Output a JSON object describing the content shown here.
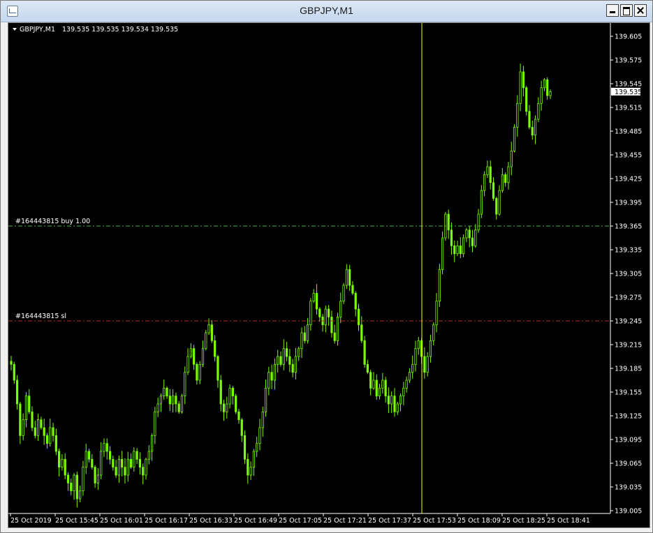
{
  "window": {
    "title": "GBPJPY,M1",
    "minimize_icon": "minimize-icon",
    "maximize_icon": "maximize-icon",
    "close_icon": "close-icon"
  },
  "chart_header": {
    "symbol_label": "GBPJPY,M1",
    "ohlc": "139.535 139.535 139.534 139.535"
  },
  "colors": {
    "background": "#000000",
    "candle": "#7CFC00",
    "buy_line": "#4caf50",
    "sl_line": "#b03020",
    "vline": "#ffff00",
    "axis": "#ffffff"
  },
  "lines": {
    "buy_label": "#164443815 buy 1.00",
    "buy_price": 139.365,
    "sl_label": "#164443815 sl",
    "sl_price": 139.245
  },
  "price_tag": "139.535",
  "chart_data": {
    "type": "candlestick",
    "symbol": "GBPJPY",
    "timeframe": "M1",
    "y_ticks": [
      "139.605",
      "139.575",
      "139.545",
      "139.515",
      "139.485",
      "139.455",
      "139.425",
      "139.395",
      "139.365",
      "139.335",
      "139.305",
      "139.275",
      "139.245",
      "139.215",
      "139.185",
      "139.155",
      "139.125",
      "139.095",
      "139.065",
      "139.035",
      "139.005"
    ],
    "ylim": [
      139.005,
      139.605
    ],
    "x_ticks": [
      "25 Oct 2019",
      "25 Oct 15:45",
      "25 Oct 16:01",
      "25 Oct 16:17",
      "25 Oct 16:33",
      "25 Oct 16:49",
      "25 Oct 17:05",
      "25 Oct 17:21",
      "25 Oct 17:37",
      "25 Oct 17:53",
      "25 Oct 18:09",
      "25 Oct 18:25",
      "25 Oct 18:41"
    ],
    "close_series": [
      139.19,
      139.17,
      139.14,
      139.1,
      139.12,
      139.15,
      139.13,
      139.11,
      139.1,
      139.12,
      139.11,
      139.1,
      139.09,
      139.11,
      139.1,
      139.08,
      139.06,
      139.07,
      139.05,
      139.04,
      139.03,
      139.05,
      139.02,
      139.03,
      139.06,
      139.08,
      139.07,
      139.06,
      139.04,
      139.05,
      139.08,
      139.09,
      139.08,
      139.07,
      139.06,
      139.05,
      139.07,
      139.06,
      139.05,
      139.07,
      139.06,
      139.08,
      139.07,
      139.06,
      139.05,
      139.07,
      139.08,
      139.1,
      139.13,
      139.14,
      139.15,
      139.16,
      139.15,
      139.14,
      139.15,
      139.14,
      139.13,
      139.15,
      139.18,
      139.2,
      139.21,
      139.19,
      139.17,
      139.19,
      139.21,
      139.23,
      139.24,
      139.22,
      139.2,
      139.17,
      139.14,
      139.13,
      139.14,
      139.16,
      139.15,
      139.13,
      139.12,
      139.1,
      139.07,
      139.05,
      139.06,
      139.08,
      139.09,
      139.11,
      139.13,
      139.16,
      139.18,
      139.17,
      139.19,
      139.2,
      139.19,
      139.21,
      139.2,
      139.19,
      139.18,
      139.2,
      139.21,
      139.23,
      139.22,
      139.24,
      139.27,
      139.28,
      139.26,
      139.25,
      139.24,
      139.26,
      139.25,
      139.23,
      139.22,
      139.25,
      139.27,
      139.29,
      139.31,
      139.29,
      139.28,
      139.26,
      139.24,
      139.22,
      139.19,
      139.18,
      139.16,
      139.17,
      139.15,
      139.16,
      139.17,
      139.15,
      139.14,
      139.15,
      139.13,
      139.14,
      139.15,
      139.16,
      139.17,
      139.18,
      139.19,
      139.21,
      139.22,
      139.2,
      139.18,
      139.2,
      139.22,
      139.24,
      139.27,
      139.31,
      139.35,
      139.38,
      139.36,
      139.34,
      139.33,
      139.34,
      139.33,
      139.35,
      139.36,
      139.35,
      139.34,
      139.36,
      139.38,
      139.41,
      139.43,
      139.44,
      139.42,
      139.4,
      139.38,
      139.41,
      139.43,
      139.42,
      139.44,
      139.46,
      139.49,
      139.52,
      139.56,
      139.54,
      139.51,
      139.49,
      139.48,
      139.5,
      139.52,
      139.54,
      139.55,
      139.53,
      139.535
    ]
  },
  "vline_label": "25 Oct 17:53"
}
